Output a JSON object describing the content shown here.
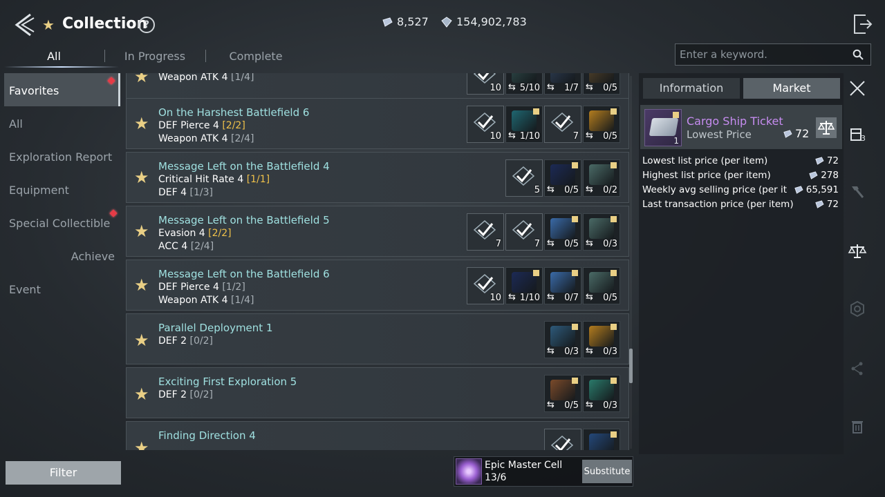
{
  "header": {
    "title": "Collection",
    "help": "?",
    "currency_1": "8,527",
    "currency_2": "154,902,783"
  },
  "tabs": [
    "All",
    "In Progress",
    "Complete"
  ],
  "search": {
    "placeholder": "Enter a keyword."
  },
  "sidebar": {
    "items": [
      {
        "label": "Favorites"
      },
      {
        "label": "All"
      },
      {
        "label": "Exploration Report"
      },
      {
        "label": "Equipment"
      },
      {
        "label": "Special Collectible"
      },
      {
        "label": "Achieve"
      },
      {
        "label": "Event"
      }
    ]
  },
  "collections": [
    {
      "name": "",
      "stats": [
        {
          "text": "Weapon ATK 4",
          "progress": "[1/4]",
          "full": false
        }
      ],
      "slots": [
        {
          "owned": true,
          "check": true,
          "count": "10",
          "art": "#3a4a52"
        },
        {
          "owned": false,
          "swap": true,
          "count": "5/10",
          "art": "#2e4a4a"
        },
        {
          "owned": false,
          "swap": true,
          "count": "1/7",
          "art": "#2e3e55"
        },
        {
          "owned": false,
          "swap": true,
          "count": "0/5",
          "art": "#55442a"
        }
      ]
    },
    {
      "name": "On the Harshest Battlefield 6",
      "stats": [
        {
          "text": "DEF Pierce 4",
          "progress": "[2/2]",
          "full": true
        },
        {
          "text": "Weapon ATK 4",
          "progress": "[2/4]",
          "full": false
        }
      ],
      "slots": [
        {
          "owned": true,
          "check": true,
          "count": "10",
          "art": "#3a4a52"
        },
        {
          "owned": false,
          "swap": true,
          "count": "1/10",
          "art": "#1f6670",
          "tag": true
        },
        {
          "owned": true,
          "check": true,
          "count": "7",
          "art": "#3a4a52"
        },
        {
          "owned": false,
          "swap": true,
          "count": "0/5",
          "art": "#b37c1e",
          "tag": true
        }
      ]
    },
    {
      "name": "Message Left on the Battlefield 4",
      "stats": [
        {
          "text": "Critical Hit Rate 4",
          "progress": "[1/1]",
          "full": true
        },
        {
          "text": "DEF 4",
          "progress": "[1/3]",
          "full": false
        }
      ],
      "slots": [
        {
          "owned": true,
          "check": true,
          "count": "5",
          "art": "#3a4a52"
        },
        {
          "owned": false,
          "swap": true,
          "count": "0/5",
          "art": "#1c2a55",
          "tag": true
        },
        {
          "owned": false,
          "swap": true,
          "count": "0/2",
          "art": "#4a6a66",
          "tag": true
        }
      ]
    },
    {
      "name": "Message Left on the Battlefield 5",
      "stats": [
        {
          "text": "Evasion 4",
          "progress": "[2/2]",
          "full": true
        },
        {
          "text": "ACC 4",
          "progress": "[2/4]",
          "full": false
        }
      ],
      "slots": [
        {
          "owned": true,
          "check": true,
          "count": "7",
          "art": "#3a4a52"
        },
        {
          "owned": true,
          "check": true,
          "count": "7",
          "art": "#3a4a52"
        },
        {
          "owned": false,
          "swap": true,
          "count": "0/5",
          "art": "#3a6aa8",
          "tag": true
        },
        {
          "owned": false,
          "swap": true,
          "count": "0/3",
          "art": "#4a6a66",
          "tag": true
        }
      ]
    },
    {
      "name": "Message Left on the Battlefield 6",
      "stats": [
        {
          "text": "DEF Pierce 4",
          "progress": "[1/2]",
          "full": false
        },
        {
          "text": "Weapon ATK 4",
          "progress": "[1/4]",
          "full": false
        }
      ],
      "slots": [
        {
          "owned": true,
          "check": true,
          "count": "10",
          "art": "#3a4a52"
        },
        {
          "owned": false,
          "swap": true,
          "count": "1/10",
          "art": "#1c2a55",
          "tag": true
        },
        {
          "owned": false,
          "swap": true,
          "count": "0/7",
          "art": "#3a6aa8",
          "tag": true
        },
        {
          "owned": false,
          "swap": true,
          "count": "0/5",
          "art": "#4a6a66",
          "tag": true
        }
      ]
    },
    {
      "name": "Parallel Deployment 1",
      "stats": [
        {
          "text": "DEF 2",
          "progress": "[0/2]",
          "full": false
        }
      ],
      "slots": [
        {
          "owned": false,
          "swap": true,
          "count": "0/3",
          "art": "#2e5a7a",
          "tag": true
        },
        {
          "owned": false,
          "swap": true,
          "count": "0/3",
          "art": "#b37c1e",
          "tag": true
        }
      ]
    },
    {
      "name": "Exciting First Exploration 5",
      "stats": [
        {
          "text": "DEF 2",
          "progress": "[0/2]",
          "full": false
        }
      ],
      "slots": [
        {
          "owned": false,
          "swap": true,
          "count": "0/5",
          "art": "#7a4a2a",
          "tag": true
        },
        {
          "owned": false,
          "swap": true,
          "count": "0/3",
          "art": "#2a7a6a",
          "tag": true
        }
      ]
    },
    {
      "name": "Finding Direction 4",
      "stats": [],
      "slots": [
        {
          "owned": true,
          "check": true,
          "count": "",
          "art": "#3a4a52"
        },
        {
          "owned": false,
          "swap": false,
          "count": "",
          "art": "#24487a",
          "tag": true
        }
      ]
    }
  ],
  "right_panel": {
    "tab_info": "Information",
    "tab_market": "Market",
    "item": {
      "name": "Cargo Ship Ticket",
      "subtitle": "Lowest Price",
      "price": "72",
      "qty": "1"
    },
    "prices": [
      {
        "label": "Lowest list price (per item)",
        "value": "72"
      },
      {
        "label": "Highest list price (per item)",
        "value": "278"
      },
      {
        "label": "Weekly avg selling price (per item)",
        "value": "65,591"
      },
      {
        "label": "Last transaction price (per item)",
        "value": "72"
      }
    ],
    "toolbar_badge": "3"
  },
  "bottom": {
    "filter": "Filter",
    "cell_name": "Epic Master Cell",
    "cell_count": "13/6",
    "substitute": "Substitute"
  },
  "colors": {
    "accent_gold": "#e9cf85",
    "name_cyan": "#9fe0e0",
    "progress_full": "#f0c24a",
    "epic_purple": "#c68cf0",
    "alert_red": "#e63b46"
  }
}
